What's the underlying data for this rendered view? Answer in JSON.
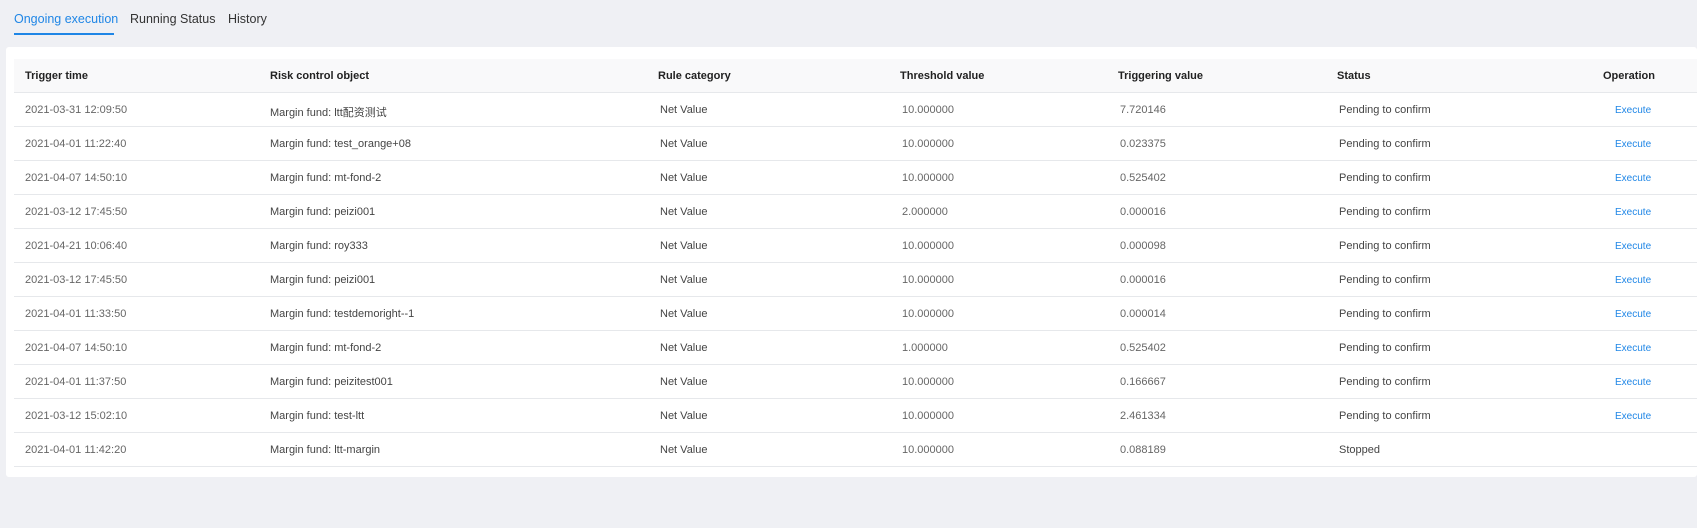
{
  "tabs": [
    {
      "label": "Ongoing execution",
      "active": true
    },
    {
      "label": "Running Status",
      "active": false
    },
    {
      "label": "History",
      "active": false
    }
  ],
  "colors": {
    "accent": "#1f86e6",
    "page_bg": "#eff0f4",
    "panel_bg": "#ffffff",
    "header_bg": "#f9f9fa"
  },
  "table": {
    "columns": [
      "Trigger time",
      "Risk control object",
      "Rule category",
      "Threshold value",
      "Triggering value",
      "Status",
      "Operation"
    ],
    "rows": [
      {
        "time": "2021-03-31 12:09:50",
        "object": "Margin fund: ltt配资测试",
        "category": "Net Value",
        "threshold": "10.000000",
        "triggering": "7.720146",
        "status": "Pending to confirm",
        "operation": "Execute"
      },
      {
        "time": "2021-04-01 11:22:40",
        "object": "Margin fund: test_orange+08",
        "category": "Net Value",
        "threshold": "10.000000",
        "triggering": "0.023375",
        "status": "Pending to confirm",
        "operation": "Execute"
      },
      {
        "time": "2021-04-07 14:50:10",
        "object": "Margin fund: mt-fond-2",
        "category": "Net Value",
        "threshold": "10.000000",
        "triggering": "0.525402",
        "status": "Pending to confirm",
        "operation": "Execute"
      },
      {
        "time": "2021-03-12 17:45:50",
        "object": "Margin fund: peizi001",
        "category": "Net Value",
        "threshold": "2.000000",
        "triggering": "0.000016",
        "status": "Pending to confirm",
        "operation": "Execute"
      },
      {
        "time": "2021-04-21 10:06:40",
        "object": "Margin fund: roy333",
        "category": "Net Value",
        "threshold": "10.000000",
        "triggering": "0.000098",
        "status": "Pending to confirm",
        "operation": "Execute"
      },
      {
        "time": "2021-03-12 17:45:50",
        "object": "Margin fund: peizi001",
        "category": "Net Value",
        "threshold": "10.000000",
        "triggering": "0.000016",
        "status": "Pending to confirm",
        "operation": "Execute"
      },
      {
        "time": "2021-04-01 11:33:50",
        "object": "Margin fund: testdemoright--1",
        "category": "Net Value",
        "threshold": "10.000000",
        "triggering": "0.000014",
        "status": "Pending to confirm",
        "operation": "Execute"
      },
      {
        "time": "2021-04-07 14:50:10",
        "object": "Margin fund: mt-fond-2",
        "category": "Net Value",
        "threshold": "1.000000",
        "triggering": "0.525402",
        "status": "Pending to confirm",
        "operation": "Execute"
      },
      {
        "time": "2021-04-01 11:37:50",
        "object": "Margin fund: peizitest001",
        "category": "Net Value",
        "threshold": "10.000000",
        "triggering": "0.166667",
        "status": "Pending to confirm",
        "operation": "Execute"
      },
      {
        "time": "2021-03-12 15:02:10",
        "object": "Margin fund: test-ltt",
        "category": "Net Value",
        "threshold": "10.000000",
        "triggering": "2.461334",
        "status": "Pending to confirm",
        "operation": "Execute"
      },
      {
        "time": "2021-04-01 11:42:20",
        "object": "Margin fund: ltt-margin",
        "category": "Net Value",
        "threshold": "10.000000",
        "triggering": "0.088189",
        "status": "Stopped",
        "operation": ""
      }
    ]
  }
}
